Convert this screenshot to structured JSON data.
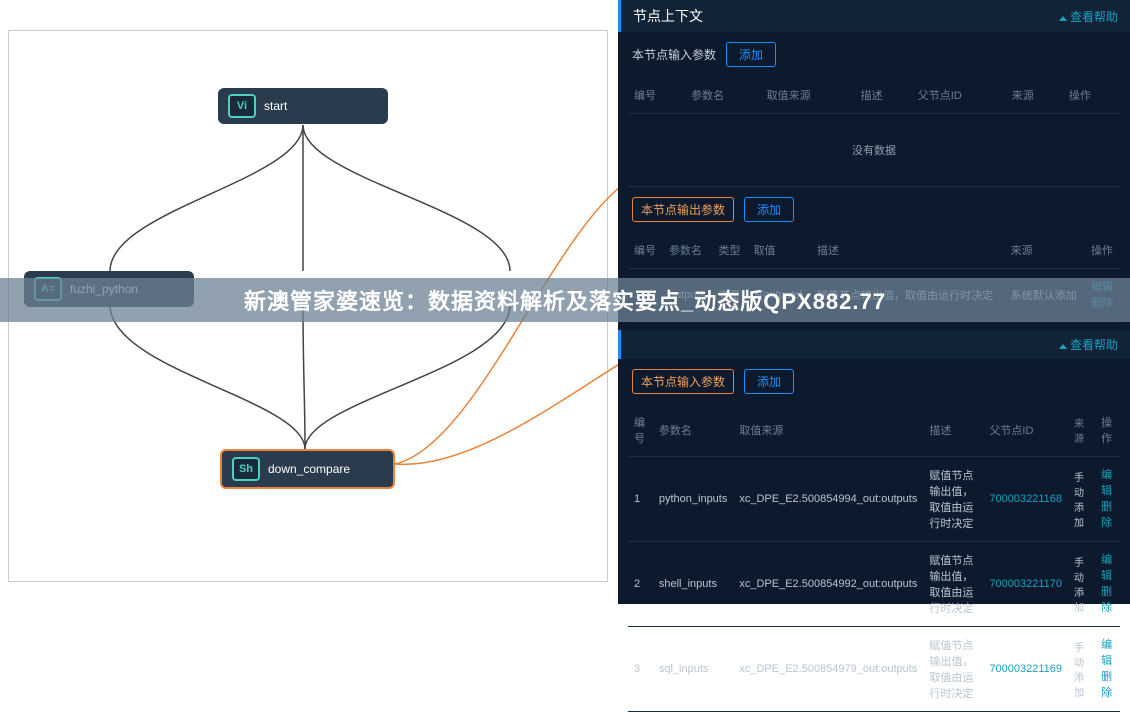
{
  "canvas": {
    "nodes": {
      "start": {
        "badge": "Vi",
        "label": "start"
      },
      "fuzhi": {
        "badge": "A=",
        "label": "fuzhi_python"
      },
      "down": {
        "badge": "Sh",
        "label": "down_compare"
      }
    }
  },
  "panel1": {
    "title": "节点上下文",
    "help": "查看帮助",
    "input_section": "本节点输入参数",
    "add": "添加",
    "input_cols": [
      "编号",
      "参数名",
      "取值来源",
      "描述",
      "父节点ID",
      "来源",
      "操作"
    ],
    "empty": "没有数据",
    "output_section": "本节点输出参数",
    "output_cols": [
      "编号",
      "参数名",
      "类型",
      "取值",
      "描述",
      "来源",
      "操作"
    ],
    "output_row": {
      "idx": "1",
      "name": "outputs",
      "type": "变量",
      "val": "${outputs}",
      "desc": "赋值节点输出值，取值由运行时决定",
      "src": "系统默认添加",
      "edit": "编辑",
      "del": "删除"
    }
  },
  "panel2": {
    "help": "查看帮助",
    "input_section": "本节点输入参数",
    "add": "添加",
    "cols": [
      "编号",
      "参数名",
      "取值来源",
      "描述",
      "父节点ID",
      "来源",
      "操作"
    ],
    "rows": [
      {
        "idx": "1",
        "name": "python_inputs",
        "val": "xc_DPE_E2.500854994_out:outputs",
        "desc": "赋值节点输出值，取值由运行时决定",
        "pid": "700003221168",
        "src": "手动添加",
        "edit": "编辑",
        "del": "删除"
      },
      {
        "idx": "2",
        "name": "shell_inputs",
        "val": "xc_DPE_E2.500854992_out:outputs",
        "desc": "赋值节点输出值，取值由运行时决定",
        "pid": "700003221170",
        "src": "手动添加",
        "edit": "编辑",
        "del": "删除"
      },
      {
        "idx": "3",
        "name": "sql_inputs",
        "val": "xc_DPE_E2.500854979_out:outputs",
        "desc": "赋值节点输出值，取值由运行时决定",
        "pid": "700003221169",
        "src": "手动添加",
        "edit": "编辑",
        "del": "删除"
      }
    ]
  },
  "overlay": "新澳管家婆速览：数据资料解析及落实要点_动态版QPX882.77"
}
